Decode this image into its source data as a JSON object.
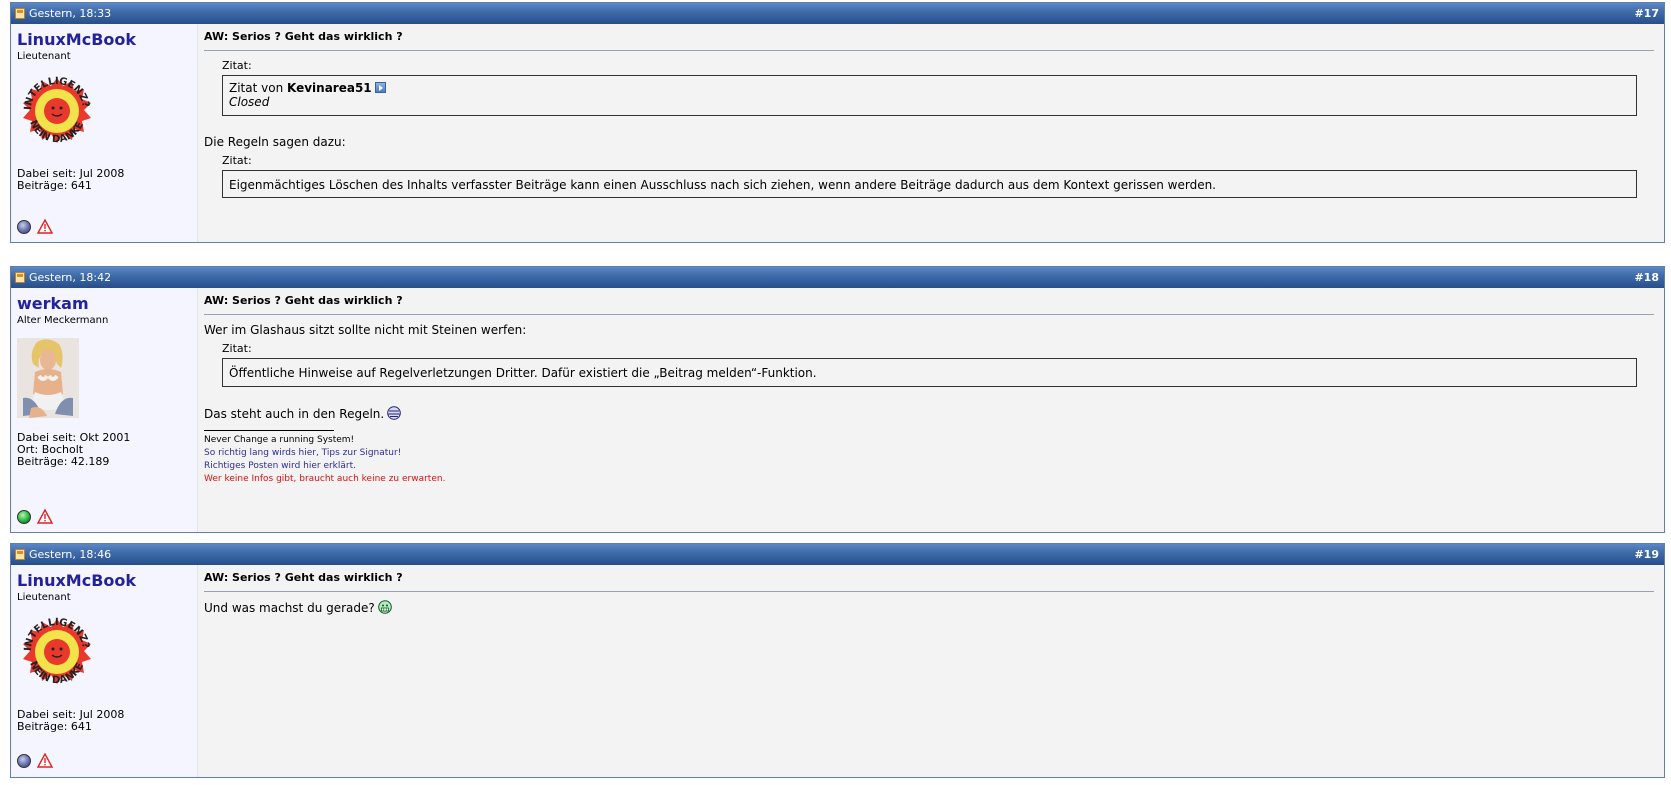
{
  "posts": [
    {
      "date": "Gestern, 18:33",
      "number": "#17",
      "username": "LinuxMcBook",
      "user_title": "Lieutenant",
      "avatar_text_top": "INTELLIGENZ?",
      "avatar_text_bottom": "NEIN DANKE",
      "joined": "Dabei seit: Jul 2008",
      "posts_count": "Beiträge: 641",
      "online": false,
      "title": "AW: Serios ? Geht das wirklich ?",
      "quote1_label": "Zitat:",
      "quote1_prefix": "Zitat von ",
      "quote1_author": "Kevinarea51",
      "quote1_text": "Closed",
      "text1": "Die Regeln sagen dazu:",
      "quote2_label": "Zitat:",
      "quote2_text": "Eigenmächtiges Löschen des Inhalts verfasster Beiträge kann einen Ausschluss nach sich ziehen, wenn andere Beiträge dadurch aus dem Kontext gerissen werden."
    },
    {
      "date": "Gestern, 18:42",
      "number": "#18",
      "username": "werkam",
      "user_title": "Alter Meckermann",
      "joined": "Dabei seit: Okt 2001",
      "location": "Ort: Bocholt",
      "posts_count": "Beiträge: 42.189",
      "online": true,
      "title": "AW: Serios ? Geht das wirklich ?",
      "text1": "Wer im Glashaus sitzt sollte nicht mit Steinen werfen:",
      "quote_label": "Zitat:",
      "quote_text": "Öffentliche Hinweise auf Regelverletzungen Dritter. Dafür existiert die „Beitrag melden“-Funktion.",
      "text2": "Das steht auch in den Regeln.",
      "signature": [
        "Never Change a running System!",
        "So richtig lang wirds hier, Tips zur Signatur!",
        "Richtiges Posten wird hier erklärt.",
        "Wer keine Infos gibt, braucht auch keine zu erwarten."
      ],
      "colors": {
        "sig_link": "#2c2c99",
        "sig_warning": "#e01010"
      }
    },
    {
      "date": "Gestern, 18:46",
      "number": "#19",
      "username": "LinuxMcBook",
      "user_title": "Lieutenant",
      "avatar_text_top": "INTELLIGENZ?",
      "avatar_text_bottom": "NEIN DANKE",
      "joined": "Dabei seit: Jul 2008",
      "posts_count": "Beiträge: 641",
      "online": false,
      "title": "AW: Serios ? Geht das wirklich ?",
      "text1": "Und was machst du gerade?"
    }
  ],
  "icons": {
    "post_icon": "post-icon",
    "online_status": "online-status-icon",
    "report": "report-warning-icon",
    "goto_post": "view-post-icon",
    "smiley_1": "smiley-icon",
    "smiley_2": "smiley-icon"
  },
  "colors": {
    "header_top": "#5b87c6",
    "header_bottom": "#27508f",
    "username": "#22229c",
    "side_bg": "#f5f5ff",
    "content_bg": "#f3f3f3"
  }
}
